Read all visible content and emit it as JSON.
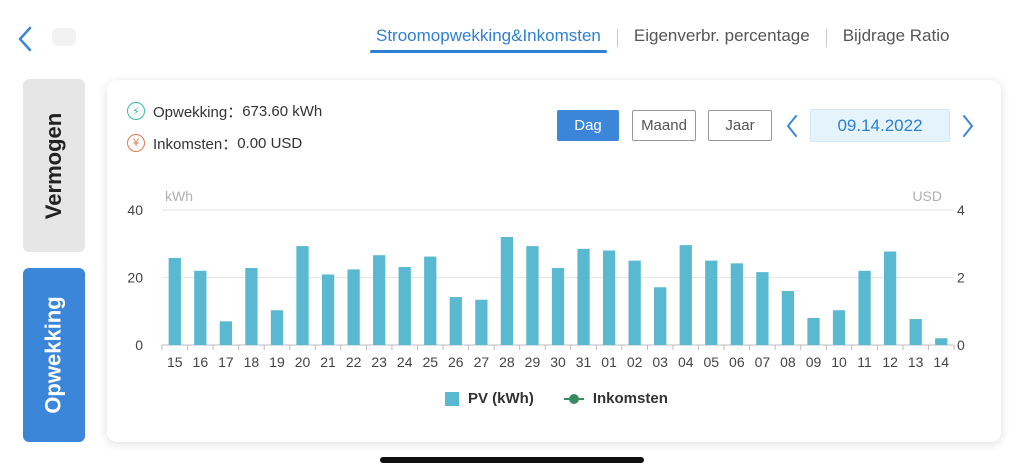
{
  "header": {
    "tabs": [
      {
        "label": "Stroomopwekking&Inkomsten",
        "active": true
      },
      {
        "label": "Eigenverbr. percentage",
        "active": false
      },
      {
        "label": "Bijdrage Ratio",
        "active": false
      }
    ]
  },
  "sidebar": {
    "items": [
      {
        "label": "Vermogen",
        "active": false
      },
      {
        "label": "Opwekking",
        "active": true
      }
    ]
  },
  "summary": {
    "generation_label": "Opwekking：",
    "generation_value": "673.60 kWh",
    "income_label": "Inkomsten：",
    "income_value": "0.00 USD",
    "generation_icon": "lightning-icon",
    "income_icon": "yen-icon"
  },
  "controls": {
    "period_buttons": [
      "Dag",
      "Maand",
      "Jaar"
    ],
    "selected_period": "Dag",
    "date": "09.14.2022"
  },
  "colors": {
    "accent": "#3c86d9",
    "bar": "#58b9d1",
    "income_line": "#3a8c60"
  },
  "chart_data": {
    "type": "bar",
    "left_unit": "kWh",
    "right_unit": "USD",
    "categories": [
      "15",
      "16",
      "17",
      "18",
      "19",
      "20",
      "21",
      "22",
      "23",
      "24",
      "25",
      "26",
      "27",
      "28",
      "29",
      "30",
      "31",
      "01",
      "02",
      "03",
      "04",
      "05",
      "06",
      "07",
      "08",
      "09",
      "10",
      "11",
      "12",
      "13",
      "14"
    ],
    "series": [
      {
        "name": "PV (kWh)",
        "axis": "left",
        "values": [
          25.8,
          22.0,
          7.0,
          22.8,
          10.3,
          29.3,
          20.9,
          22.4,
          26.6,
          23.1,
          26.2,
          14.2,
          13.4,
          32.0,
          29.3,
          22.8,
          28.5,
          28.0,
          25.0,
          17.1,
          29.6,
          25.0,
          24.2,
          21.6,
          16.0,
          8.0,
          10.3,
          22.0,
          27.7,
          7.7,
          2.0
        ]
      },
      {
        "name": "Inkomsten",
        "axis": "right",
        "values": [
          0,
          0,
          0,
          0,
          0,
          0,
          0,
          0,
          0,
          0,
          0,
          0,
          0,
          0,
          0,
          0,
          0,
          0,
          0,
          0,
          0,
          0,
          0,
          0,
          0,
          0,
          0,
          0,
          0,
          0,
          0
        ]
      }
    ],
    "ylim_left": [
      0,
      40
    ],
    "yticks_left": [
      0,
      20,
      40
    ],
    "ylim_right": [
      0,
      4
    ],
    "yticks_right": [
      0,
      2,
      4
    ],
    "grid": true,
    "legend_position": "bottom"
  }
}
